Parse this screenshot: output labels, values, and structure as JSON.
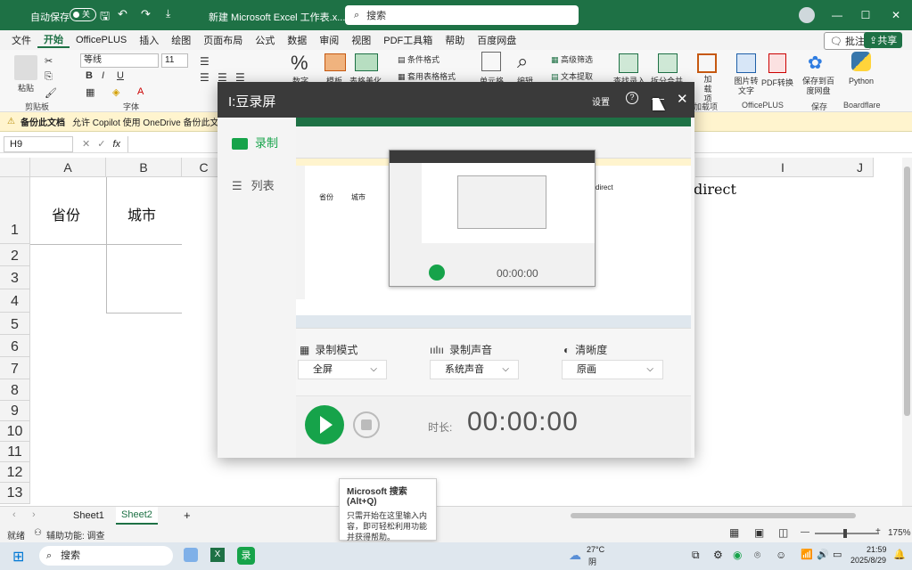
{
  "titlebar": {
    "autosave": "自动保存",
    "autosave_state": "关",
    "doc_title": "新建 Microsoft Excel 工作表.x...",
    "search_placeholder": "搜索",
    "min": "—",
    "max": "☐",
    "close": "✕"
  },
  "menu": [
    "文件",
    "开始",
    "OfficePLUS",
    "插入",
    "绘图",
    "页面布局",
    "公式",
    "数据",
    "审阅",
    "视图",
    "PDF工具箱",
    "帮助",
    "百度网盘"
  ],
  "menu_right": {
    "comment": "批注",
    "share": "共享"
  },
  "ribbon": {
    "paste": "粘贴",
    "clipboard": "剪贴板",
    "font_name": "等线",
    "font_size": "11",
    "font_group": "字体",
    "number": "数字",
    "cond_format": "条件格式",
    "table_style": "套用表格格式",
    "template": "模板",
    "table_beautify": "表格美化",
    "cell": "单元格",
    "edit": "编辑",
    "adv_filter": "高级筛选",
    "text_extract": "文本提取",
    "lookup_entry": "查找录入",
    "split_merge": "拆分合并",
    "addin": "加载项",
    "addin_group": "加载项",
    "image_to_text": "图片转文字",
    "pdf_convert": "PDF转换",
    "officeplus": "OfficePLUS",
    "save_baidu": "保存到百度网盘",
    "save_group": "保存",
    "python": "Python",
    "boardflare": "Boardflare"
  },
  "infobar": {
    "title": "备份此文档",
    "text": "允许 Copilot 使用 OneDrive 备份此文件和"
  },
  "formula": {
    "namebox": "H9",
    "fx": "fx"
  },
  "columns": [
    "A",
    "B",
    "C",
    "I",
    "J"
  ],
  "rows": [
    "1",
    "2",
    "3",
    "4",
    "5",
    "6",
    "7",
    "8",
    "9",
    "10",
    "11",
    "12",
    "13"
  ],
  "cells": {
    "a1": "省份",
    "b1": "城市",
    "i1": "direct"
  },
  "sheets": [
    "Sheet1",
    "Sheet2"
  ],
  "add_sheet": "+",
  "status": {
    "ready": "就绪",
    "accessibility": "辅助功能: 调查",
    "zoom": "175%"
  },
  "taskbar": {
    "search": "搜索",
    "weather_temp": "27°C",
    "weather_desc": "阴",
    "time": "21:59",
    "date": "2025/8/29"
  },
  "recorder": {
    "title": "I:豆录屏",
    "settings": "设置",
    "help": "?",
    "minimize": "—",
    "close": "✕",
    "nav_record": "录制",
    "nav_list": "列表",
    "mode_label": "录制模式",
    "mode_value": "全屏",
    "audio_label": "录制声音",
    "audio_value": "系统声音",
    "quality_label": "清晰度",
    "quality_value": "原画",
    "duration_label": "时长:",
    "duration_value": "00:00:00",
    "nested_duration": "00:00:00"
  },
  "tooltip": {
    "title": "Microsoft 搜索(Alt+Q)",
    "body": "只需开始在这里输入内容，即可轻松利用功能并获得帮助。"
  },
  "colors": {
    "excel_green": "#1e7145",
    "recorder_green": "#16a34a",
    "recorder_title_bg": "#3a3a3a"
  }
}
